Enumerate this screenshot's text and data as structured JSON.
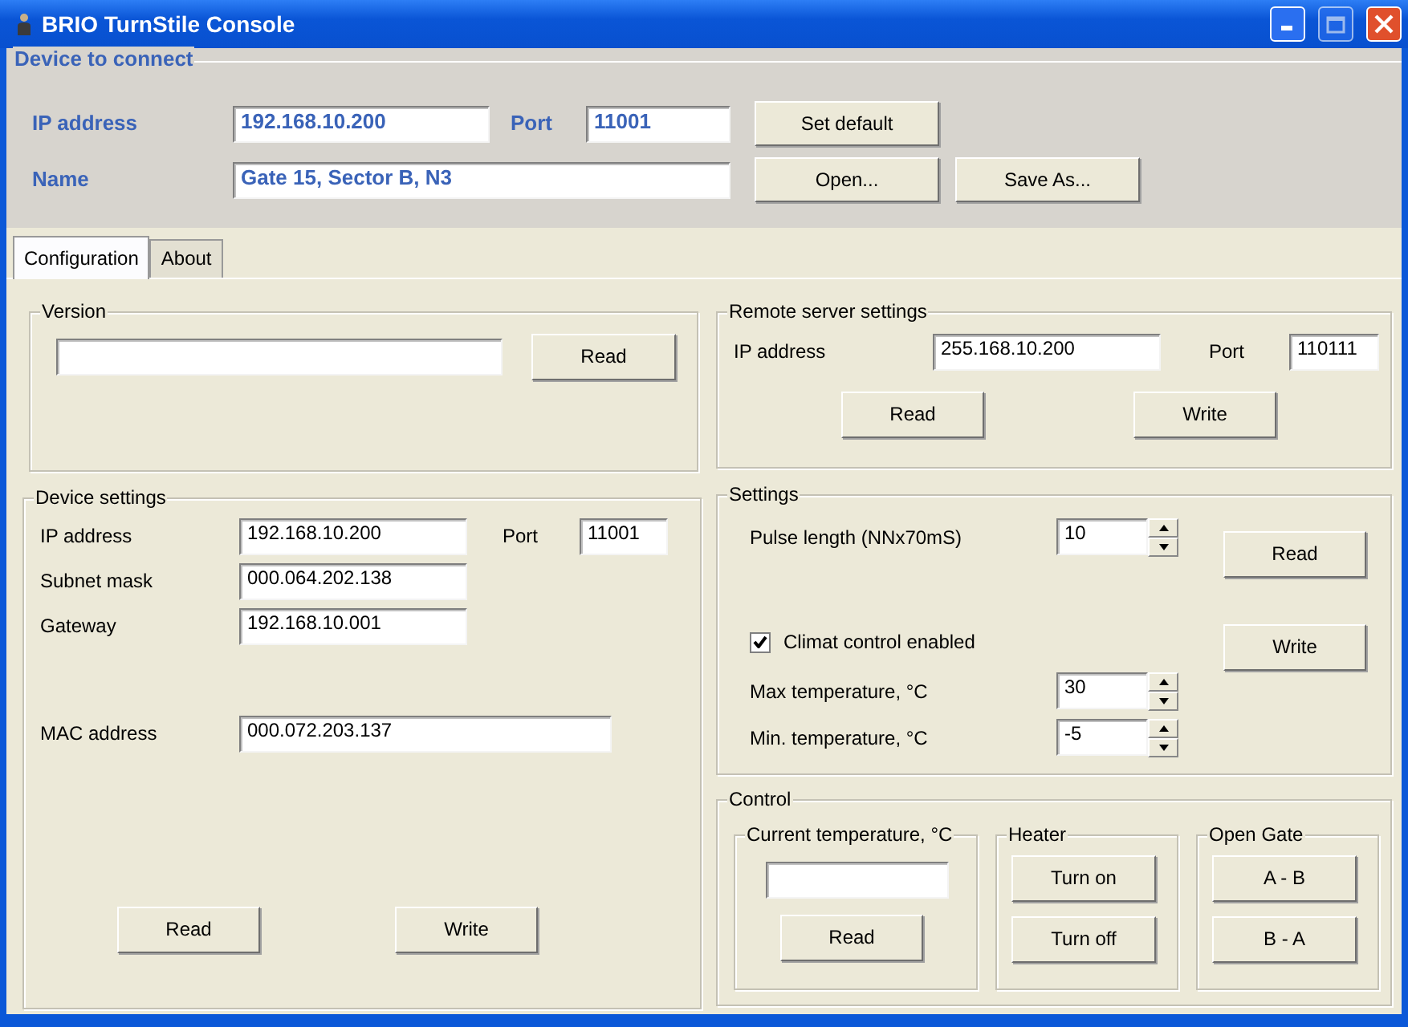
{
  "window": {
    "title": "BRIO TurnStile Console"
  },
  "device_to_connect": {
    "title": "Device to connect",
    "ip_address": {
      "label": "IP address",
      "value": "192.168.10.200"
    },
    "port": {
      "label": "Port",
      "value": "11001"
    },
    "name": {
      "label": "Name",
      "value": "Gate 15, Sector B, N3"
    },
    "buttons": [
      "Set default",
      "Open...",
      "Save As..."
    ]
  },
  "tabs": [
    {
      "label": "Configuration",
      "selected": true
    },
    {
      "label": "About",
      "selected": false
    }
  ],
  "version": {
    "title": "Version",
    "button": "Read"
  },
  "device_settings": {
    "title": "Device settings",
    "fields": [
      {
        "label": "IP address",
        "value": "192.168.10.200"
      },
      {
        "label": "Subnet mask",
        "value": "000.064.202.138"
      },
      {
        "label": "Gateway",
        "value": "192.168.10.001"
      },
      {
        "label": "MAC address",
        "value": "000.072.203.137"
      }
    ],
    "port": {
      "label": "Port",
      "value": "11001"
    },
    "buttons": [
      "Read",
      "Write"
    ]
  },
  "remote_server_settings": {
    "title": "Remote server settings",
    "ip_address": {
      "label": "IP address",
      "value": "255.168.10.200"
    },
    "port": {
      "label": "Port",
      "value": "110111"
    },
    "buttons": [
      "Read",
      "Write"
    ]
  },
  "settings": {
    "title": "Settings",
    "pulse_length": {
      "label": "Pulse length (NNx70mS)",
      "value": "10"
    },
    "climat_control": {
      "label": "Climat control enabled",
      "checked": true
    },
    "max_temperature": {
      "label": "Max temperature, °C",
      "value": "30"
    },
    "min_temperature": {
      "label": "Min. temperature, °C",
      "value": "-5"
    },
    "buttons": [
      "Read",
      "Write"
    ]
  },
  "control": {
    "title": "Control",
    "current_temperature": {
      "title": "Current temperature, °C",
      "button": "Read"
    },
    "heater": {
      "title": "Heater",
      "buttons": [
        "Turn on",
        "Turn off"
      ]
    },
    "open_gate": {
      "title": "Open Gate",
      "buttons": [
        "A - B",
        "B - A"
      ]
    }
  }
}
